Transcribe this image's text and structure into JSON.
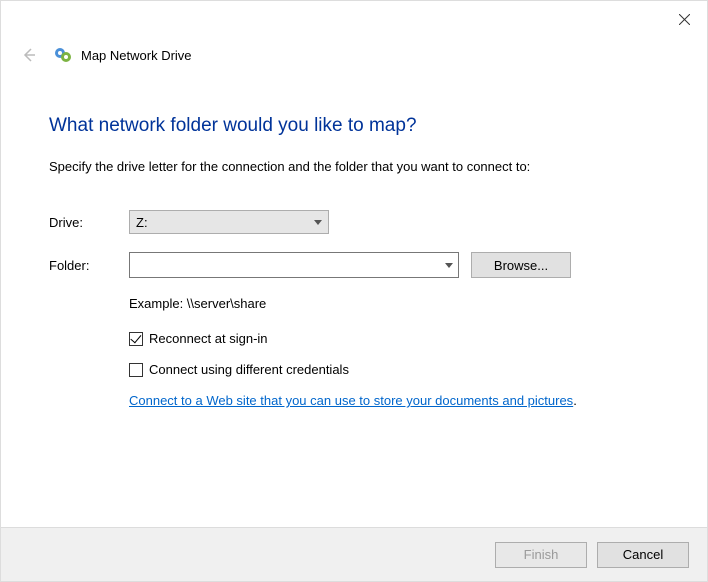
{
  "titlebar": {
    "close_label": "Close"
  },
  "header": {
    "back_label": "Back",
    "icon_label": "network-drive-icon",
    "title": "Map Network Drive"
  },
  "main": {
    "heading": "What network folder would you like to map?",
    "subtext": "Specify the drive letter for the connection and the folder that you want to connect to:",
    "drive_label": "Drive:",
    "drive_value": "Z:",
    "folder_label": "Folder:",
    "folder_value": "",
    "browse_label": "Browse...",
    "example_text": "Example: \\\\server\\share",
    "reconnect_label": "Reconnect at sign-in",
    "reconnect_checked": true,
    "credentials_label": "Connect using different credentials",
    "credentials_checked": false,
    "link_text": "Connect to a Web site that you can use to store your documents and pictures",
    "link_suffix": "."
  },
  "footer": {
    "finish_label": "Finish",
    "finish_enabled": false,
    "cancel_label": "Cancel"
  }
}
